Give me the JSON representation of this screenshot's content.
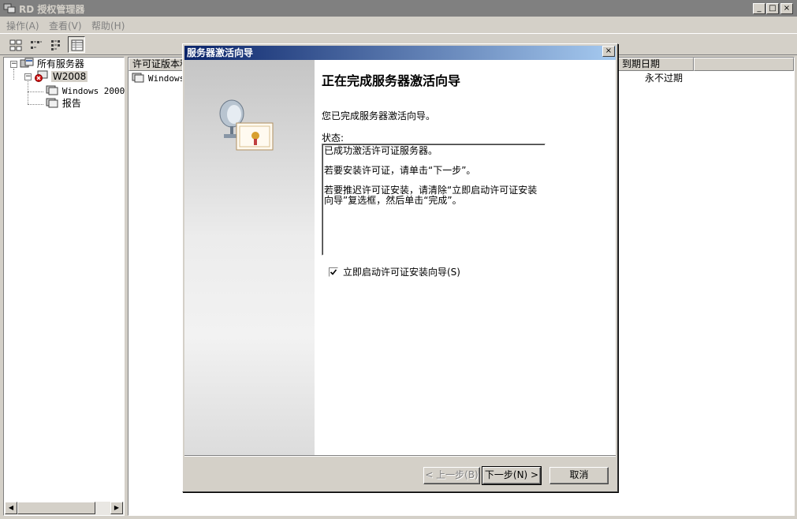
{
  "window": {
    "title": "RD 授权管理器",
    "caption_buttons": [
      "_",
      "□",
      "×"
    ]
  },
  "menu": [
    "操作(A)",
    "查看(V)",
    "帮助(H)"
  ],
  "toolbar": {
    "buttons": [
      "large-icons",
      "small-icons",
      "list",
      "details"
    ]
  },
  "tree": {
    "root": "所有服务器",
    "server": "W2008",
    "children": [
      "Windows 2000",
      "报告"
    ]
  },
  "list": {
    "columns": [
      "许可证版本和类型",
      "到期日期"
    ],
    "rows": [
      {
        "name": "Windows",
        "expiry": "永不过期"
      }
    ]
  },
  "dialog": {
    "title": "服务器激活向导",
    "close": "×",
    "heading": "正在完成服务器激活向导",
    "completed_text": "您已完成服务器激活向导。",
    "status_label": "状态:",
    "status_lines": [
      "已成功激活许可证服务器。",
      "若要安装许可证，请单击“下一步”。",
      "若要推迟许可证安装，请清除“立即启动许可证安装向导”复选框，然后单击“完成”。"
    ],
    "checkbox_label": "立即启动许可证安装向导(S)",
    "checkbox_checked": true,
    "buttons": {
      "back": "< 上一步(B)",
      "next": "下一步(N) >",
      "cancel": "取消"
    }
  },
  "scroll": {
    "left": "◀",
    "right": "▶"
  }
}
